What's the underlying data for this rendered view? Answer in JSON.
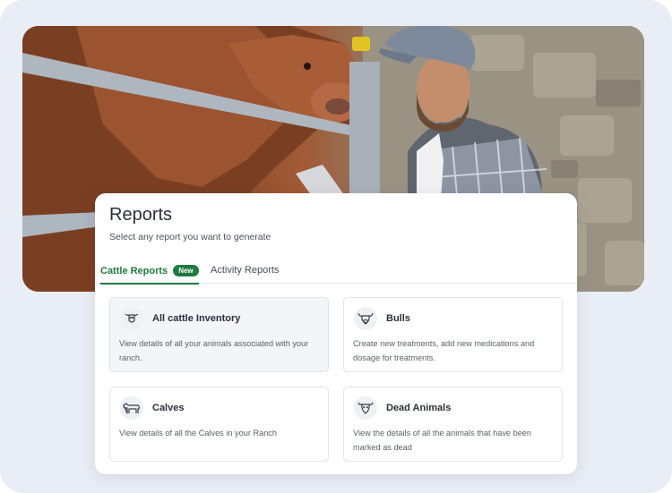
{
  "page": {
    "title": "Reports",
    "subtitle": "Select any report you want to generate"
  },
  "tabs": [
    {
      "label": "Cattle Reports",
      "badge": "New",
      "active": true
    },
    {
      "label": "Activity Reports",
      "active": false
    }
  ],
  "reports": [
    {
      "title": "All cattle Inventory",
      "description": "View details of all your animals associated with your ranch.",
      "icon": "cow-head-icon"
    },
    {
      "title": "Bulls",
      "description": "Create new treatments, add new medications and dosage for treatments.",
      "icon": "bull-head-icon"
    },
    {
      "title": "Calves",
      "description": "View details of all the Calves in your Ranch",
      "icon": "calf-icon"
    },
    {
      "title": "Dead Animals",
      "description": "View the details of all the animals that have been marked as dead",
      "icon": "dead-cow-icon"
    }
  ],
  "colors": {
    "accent": "#1f7a3f",
    "frame_background": "#e9edf5",
    "card_background": "#ffffff"
  },
  "hero": {
    "description_icon": "cattle-farmer-photo"
  }
}
